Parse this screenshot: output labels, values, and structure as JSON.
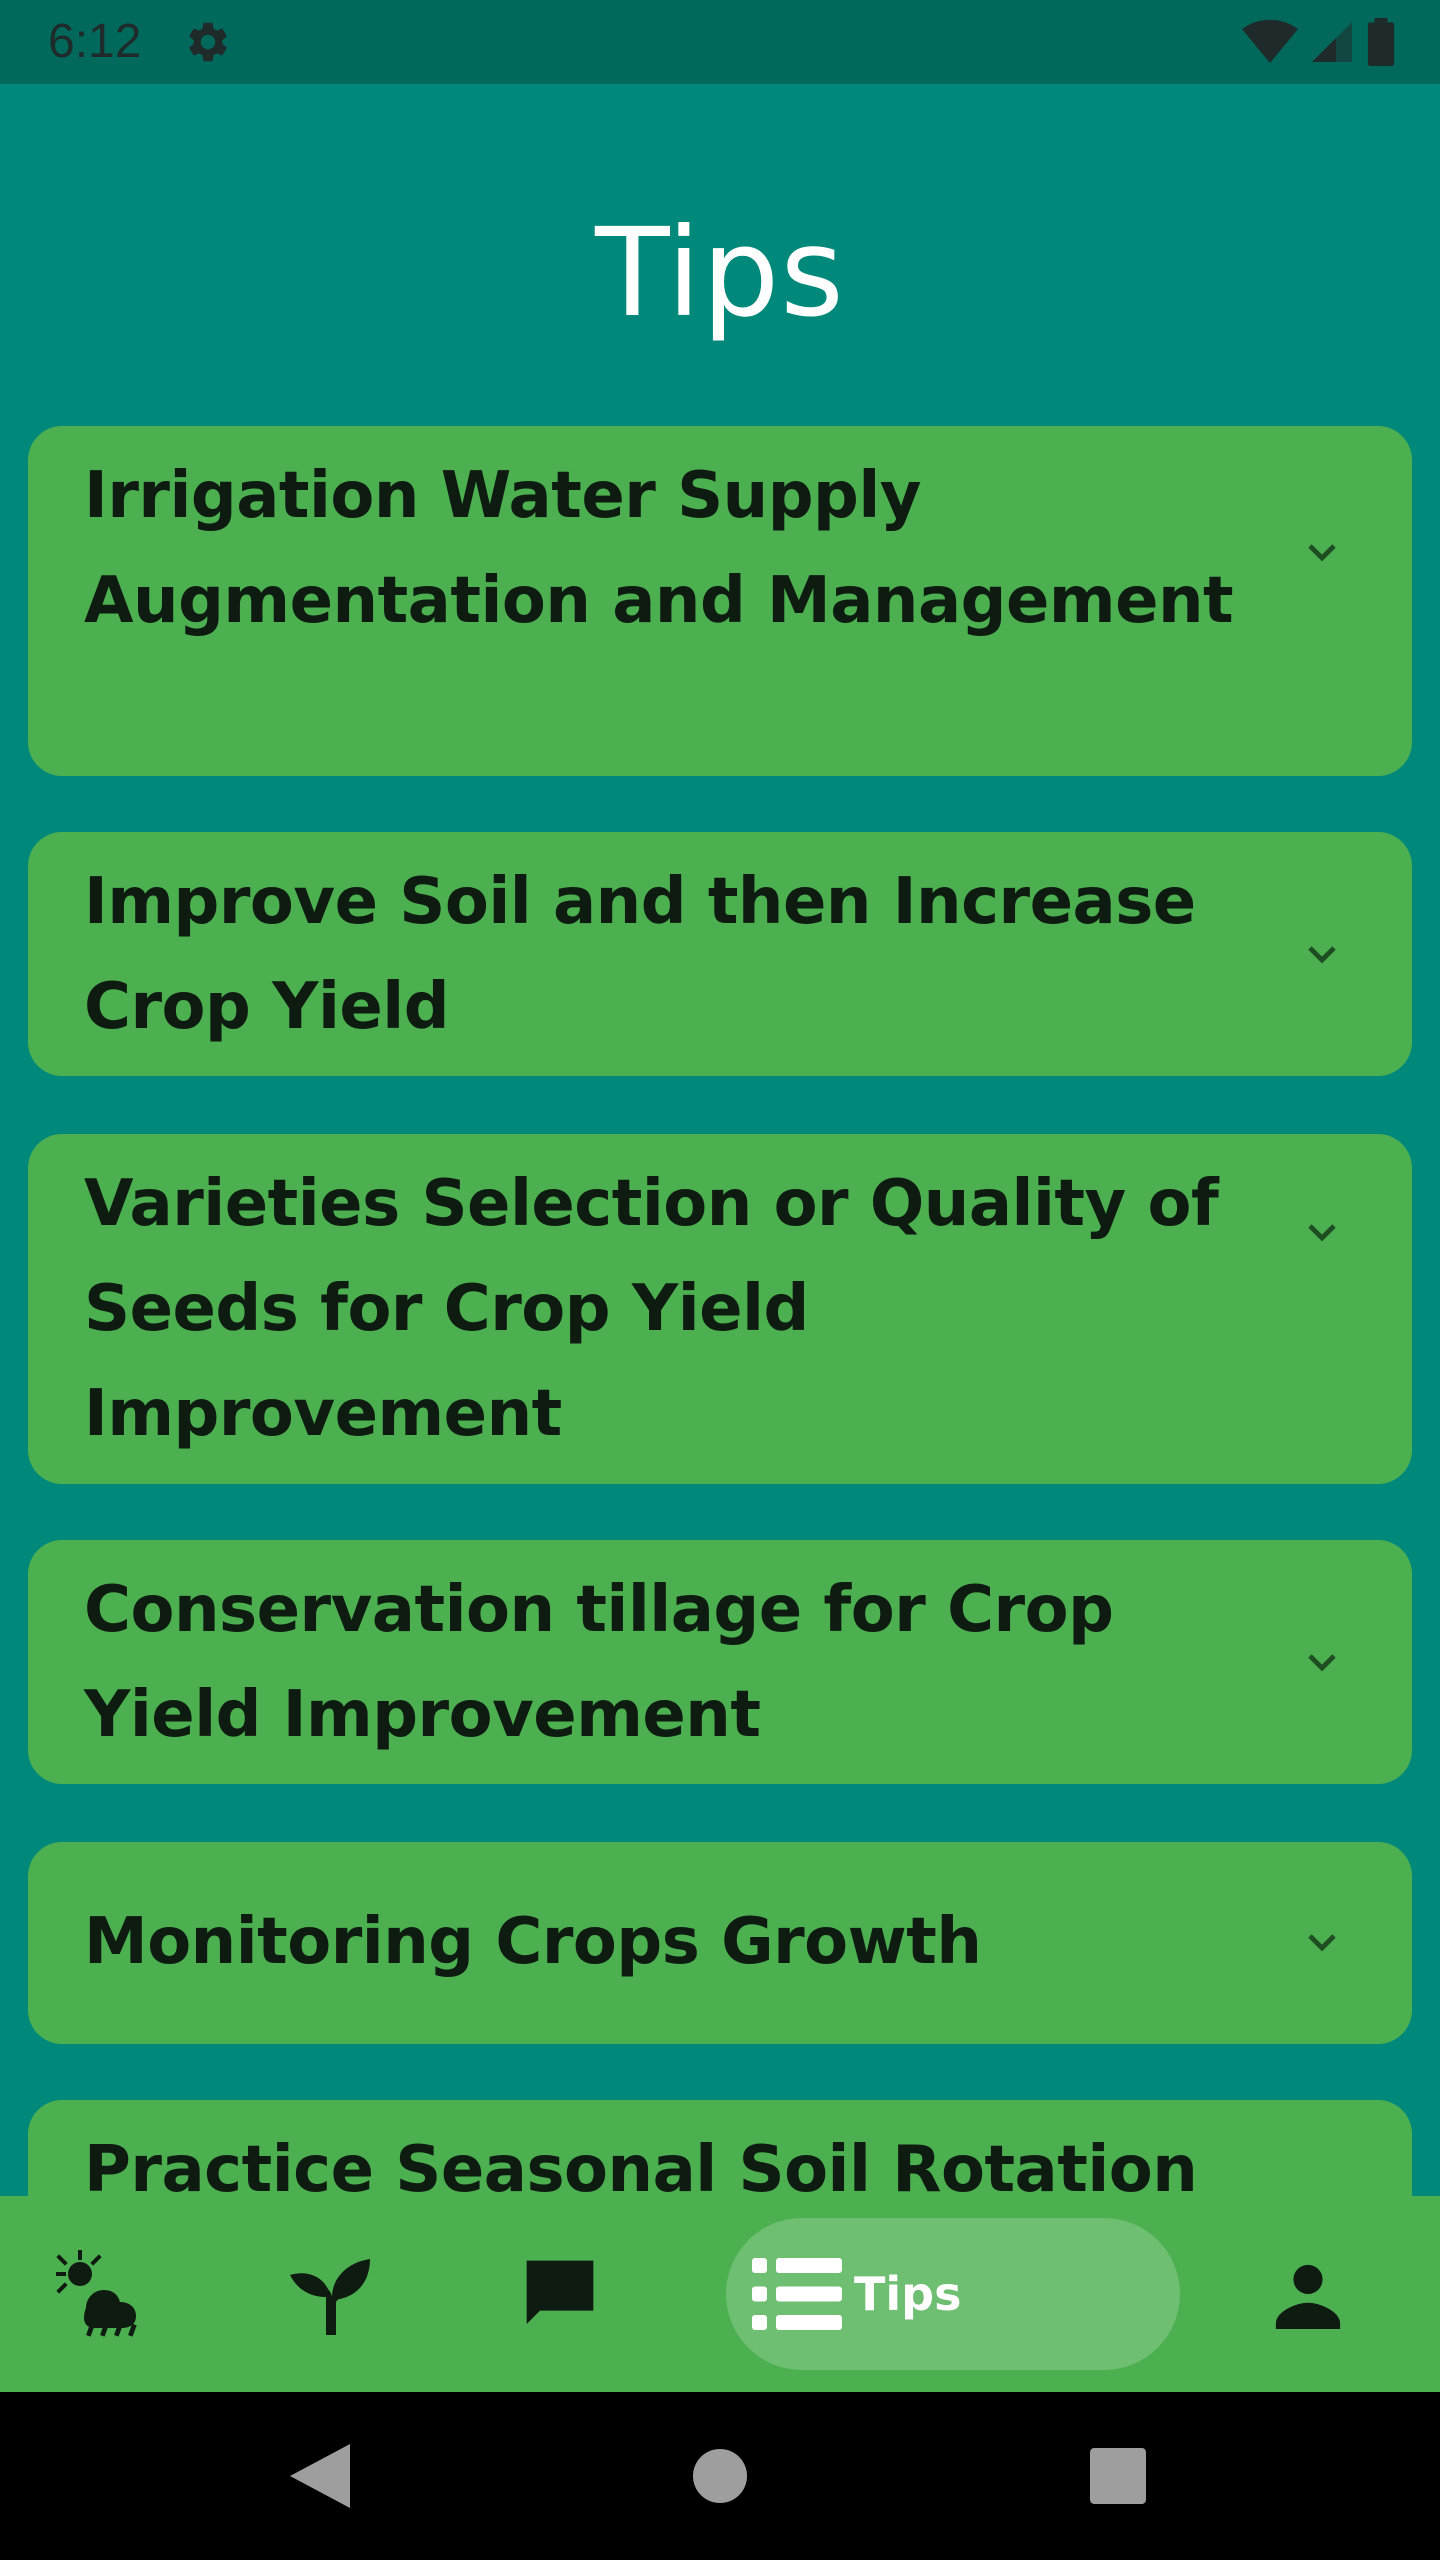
{
  "status_bar": {
    "time": "6:12",
    "icons": [
      "gear-icon",
      "wifi-icon",
      "cell-signal-icon",
      "battery-icon"
    ]
  },
  "page": {
    "title": "Tips"
  },
  "tips": [
    {
      "title": "Irrigation Water Supply Augmentation and Management"
    },
    {
      "title": "Improve Soil and then Increase Crop Yield"
    },
    {
      "title": "Varieties Selection or Quality of Seeds for Crop Yield Improvement"
    },
    {
      "title": "Conservation tillage for Crop Yield Improvement"
    },
    {
      "title": "Monitoring Crops Growth"
    },
    {
      "title": "Practice Seasonal Soil Rotation"
    }
  ],
  "bottom_nav": {
    "items": [
      {
        "icon": "weather-icon",
        "label": ""
      },
      {
        "icon": "sprout-icon",
        "label": ""
      },
      {
        "icon": "chat-icon",
        "label": ""
      },
      {
        "icon": "list-icon",
        "label": "Tips",
        "active": true
      },
      {
        "icon": "profile-icon",
        "label": ""
      }
    ]
  },
  "colors": {
    "background": "#00897B",
    "status_bar": "#00695C",
    "card": "#4CAF50",
    "nav_bar": "#4CAF50",
    "nav_active_pill": "#6EBF71",
    "text_dark": "#0e1b10",
    "text_light": "#FFFFFF"
  }
}
